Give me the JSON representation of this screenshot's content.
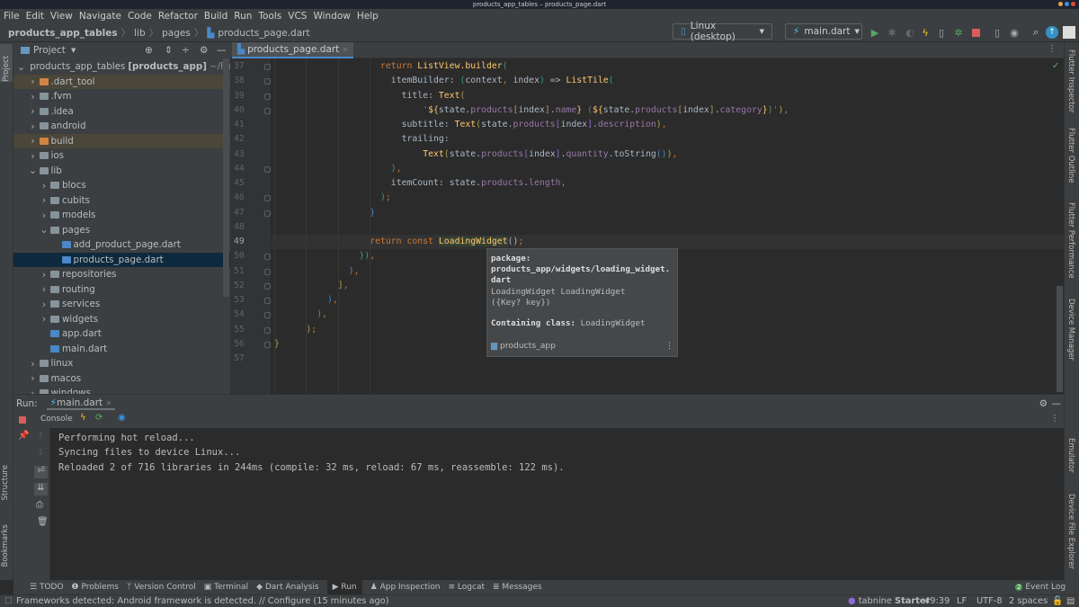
{
  "window": {
    "title": "products_app_tables – products_page.dart"
  },
  "menu": [
    "File",
    "Edit",
    "View",
    "Navigate",
    "Code",
    "Refactor",
    "Build",
    "Run",
    "Tools",
    "VCS",
    "Window",
    "Help"
  ],
  "breadcrumb": [
    "products_app_tables",
    "lib",
    "pages",
    "products_page.dart"
  ],
  "toolbar": {
    "device": "Linux (desktop)",
    "config": "main.dart",
    "icons": [
      "run-icon",
      "debug-icon",
      "profile-icon",
      "hot-reload-icon",
      "device-icon",
      "attach-debug-icon",
      "stop-icon",
      "avd-icon",
      "sdk-icon",
      "search-icon",
      "update-icon",
      "avatar-icon"
    ]
  },
  "left_strip": {
    "project": "Project",
    "structure": "Structure",
    "bookmarks": "Bookmarks"
  },
  "project_panel": {
    "title": "Project",
    "items": [
      {
        "label": "products_app_tables",
        "suffix": "[products_app]",
        "path": "~/Flutte",
        "depth": 0,
        "expanded": true,
        "type": "flutter"
      },
      {
        "label": ".dart_tool",
        "depth": 1,
        "type": "folder-excluded"
      },
      {
        "label": ".fvm",
        "depth": 1,
        "type": "folder"
      },
      {
        "label": ".idea",
        "depth": 1,
        "type": "folder"
      },
      {
        "label": "android",
        "depth": 1,
        "type": "folder"
      },
      {
        "label": "build",
        "depth": 1,
        "type": "folder-excluded"
      },
      {
        "label": "ios",
        "depth": 1,
        "type": "folder"
      },
      {
        "label": "lib",
        "depth": 1,
        "expanded": true,
        "type": "folder"
      },
      {
        "label": "blocs",
        "depth": 2,
        "type": "folder"
      },
      {
        "label": "cubits",
        "depth": 2,
        "type": "folder"
      },
      {
        "label": "models",
        "depth": 2,
        "type": "folder"
      },
      {
        "label": "pages",
        "depth": 2,
        "expanded": true,
        "type": "folder"
      },
      {
        "label": "add_product_page.dart",
        "depth": 3,
        "type": "dart"
      },
      {
        "label": "products_page.dart",
        "depth": 3,
        "type": "dart",
        "selected": true
      },
      {
        "label": "repositories",
        "depth": 2,
        "type": "folder"
      },
      {
        "label": "routing",
        "depth": 2,
        "type": "folder"
      },
      {
        "label": "services",
        "depth": 2,
        "type": "folder"
      },
      {
        "label": "widgets",
        "depth": 2,
        "type": "folder"
      },
      {
        "label": "app.dart",
        "depth": 2,
        "type": "dart"
      },
      {
        "label": "main.dart",
        "depth": 2,
        "type": "dart"
      },
      {
        "label": "linux",
        "depth": 1,
        "type": "folder"
      },
      {
        "label": "macos",
        "depth": 1,
        "type": "folder"
      },
      {
        "label": "windows",
        "depth": 1,
        "type": "folder"
      }
    ]
  },
  "editor": {
    "tab": "products_page.dart",
    "current_line": 49,
    "lines": [
      {
        "n": 37,
        "indent": 20,
        "t": [
          [
            "return ",
            "kw"
          ],
          [
            "ListView.builder",
            "fn"
          ],
          [
            "(",
            "p2"
          ]
        ]
      },
      {
        "n": 38,
        "indent": 22,
        "t": [
          [
            "itemBuilder: ",
            "pl"
          ],
          [
            "(",
            "p2"
          ],
          [
            "context",
            "pl"
          ],
          [
            ", ",
            "kw"
          ],
          [
            "index",
            "pl"
          ],
          [
            ")",
            "p2"
          ],
          [
            " => ",
            "pl"
          ],
          [
            "ListTile",
            "fn"
          ],
          [
            "(",
            "p2"
          ]
        ]
      },
      {
        "n": 39,
        "indent": 24,
        "t": [
          [
            "title: ",
            "pl"
          ],
          [
            "Text",
            "fn"
          ],
          [
            "(",
            "p3"
          ]
        ]
      },
      {
        "n": 40,
        "indent": 28,
        "t": [
          [
            "'",
            "st"
          ],
          [
            "${",
            "fn"
          ],
          [
            "state.",
            "pl"
          ],
          [
            "products",
            "pr"
          ],
          [
            "[",
            "p3"
          ],
          [
            "index",
            "pl"
          ],
          [
            "]",
            "p3"
          ],
          [
            ".",
            "pl"
          ],
          [
            "name",
            "pr"
          ],
          [
            "}",
            "fn"
          ],
          [
            " (",
            "st"
          ],
          [
            "${",
            "fn"
          ],
          [
            "state.",
            "pl"
          ],
          [
            "products",
            "pr"
          ],
          [
            "[",
            "p3"
          ],
          [
            "index",
            "pl"
          ],
          [
            "]",
            "p3"
          ],
          [
            ".",
            "pl"
          ],
          [
            "category",
            "pr"
          ],
          [
            "}",
            "fn"
          ],
          [
            ")'",
            "st"
          ],
          [
            ")",
            "p3"
          ],
          [
            ",",
            "kw"
          ]
        ]
      },
      {
        "n": 41,
        "indent": 24,
        "t": [
          [
            "subtitle: ",
            "pl"
          ],
          [
            "Text",
            "fn"
          ],
          [
            "(",
            "p3"
          ],
          [
            "state.",
            "pl"
          ],
          [
            "products",
            "pr"
          ],
          [
            "[",
            "p4"
          ],
          [
            "index",
            "pl"
          ],
          [
            "]",
            "p4"
          ],
          [
            ".",
            "pl"
          ],
          [
            "description",
            "pr"
          ],
          [
            ")",
            "p3"
          ],
          [
            ",",
            "kw"
          ]
        ]
      },
      {
        "n": 42,
        "indent": 24,
        "t": [
          [
            "trailing:",
            "pl"
          ]
        ]
      },
      {
        "n": 43,
        "indent": 28,
        "t": [
          [
            "Text",
            "fn"
          ],
          [
            "(",
            "p3"
          ],
          [
            "state.",
            "pl"
          ],
          [
            "products",
            "pr"
          ],
          [
            "[",
            "p4"
          ],
          [
            "index",
            "pl"
          ],
          [
            "]",
            "p4"
          ],
          [
            ".",
            "pl"
          ],
          [
            "quantity",
            "pr"
          ],
          [
            ".toString",
            "pl"
          ],
          [
            "()",
            "p1"
          ],
          [
            ")",
            "p3"
          ],
          [
            ",",
            "kw"
          ]
        ]
      },
      {
        "n": 44,
        "indent": 22,
        "t": [
          [
            ")",
            "p2"
          ],
          [
            ",",
            "kw"
          ]
        ]
      },
      {
        "n": 45,
        "indent": 22,
        "t": [
          [
            "itemCount: ",
            "pl"
          ],
          [
            "state.",
            "pl"
          ],
          [
            "products",
            "pr"
          ],
          [
            ".",
            "pl"
          ],
          [
            "length",
            "pr"
          ],
          [
            ",",
            "kw"
          ]
        ]
      },
      {
        "n": 46,
        "indent": 20,
        "t": [
          [
            ")",
            "p2"
          ],
          [
            ";",
            "kw"
          ]
        ]
      },
      {
        "n": 47,
        "indent": 18,
        "t": [
          [
            "}",
            "p1"
          ]
        ]
      },
      {
        "n": 48,
        "indent": 0,
        "t": []
      },
      {
        "n": 49,
        "indent": 18,
        "t": [
          [
            "return const ",
            "kw"
          ],
          [
            "LoadingWidget",
            "fn hl"
          ],
          [
            "()",
            "pl"
          ],
          [
            ";",
            "kw"
          ]
        ]
      },
      {
        "n": 50,
        "indent": 16,
        "t": [
          [
            "})",
            "p2"
          ],
          [
            ",",
            "kw"
          ]
        ]
      },
      {
        "n": 51,
        "indent": 14,
        "t": [
          [
            ")",
            "p4"
          ],
          [
            ",",
            "kw"
          ]
        ]
      },
      {
        "n": 52,
        "indent": 12,
        "t": [
          [
            "]",
            "p3"
          ],
          [
            ",",
            "kw"
          ]
        ]
      },
      {
        "n": 53,
        "indent": 10,
        "t": [
          [
            ")",
            "p1"
          ],
          [
            ",",
            "kw"
          ]
        ]
      },
      {
        "n": 54,
        "indent": 8,
        "t": [
          [
            ")",
            "p2"
          ],
          [
            ",",
            "kw"
          ]
        ]
      },
      {
        "n": 55,
        "indent": 6,
        "t": [
          [
            ")",
            "p3"
          ],
          [
            ";",
            "kw"
          ]
        ]
      },
      {
        "n": 56,
        "indent": 0,
        "t": [
          [
            "}",
            "p3"
          ]
        ]
      },
      {
        "n": 57,
        "indent": 0,
        "t": []
      }
    ]
  },
  "doc_popup": {
    "package_label": "package:",
    "package_path": "products_app/widgets/loading_widget.",
    "package_path2": "dart",
    "signature": "LoadingWidget LoadingWidget",
    "params": "({Key? key})",
    "containing_label": "Containing class:",
    "containing_value": "LoadingWidget",
    "module": "products_app"
  },
  "right_strip": [
    "Flutter Inspector",
    "Flutter Outline",
    "Flutter Performance",
    "Device Manager",
    "Emulator",
    "Device File Explorer"
  ],
  "run_panel": {
    "label": "Run:",
    "tab": "main.dart",
    "console_tab": "Console",
    "output": [
      "Performing hot reload...",
      "Syncing files to device Linux...",
      "Reloaded 2 of 716 libraries in 244ms (compile: 32 ms, reload: 67 ms, reassemble: 122 ms)."
    ]
  },
  "tool_tabs": [
    {
      "label": "TODO",
      "icon": "list-icon"
    },
    {
      "label": "Problems",
      "icon": "info-icon"
    },
    {
      "label": "Version Control",
      "icon": "branch-icon"
    },
    {
      "label": "Terminal",
      "icon": "terminal-icon"
    },
    {
      "label": "Dart Analysis",
      "icon": "dart-icon"
    },
    {
      "label": "Run",
      "icon": "play-icon",
      "active": true
    },
    {
      "label": "App Inspection",
      "icon": "inspect-icon"
    },
    {
      "label": "Logcat",
      "icon": "logcat-icon"
    },
    {
      "label": "Messages",
      "icon": "messages-icon"
    }
  ],
  "event_log": {
    "label": "Event Log",
    "count": "2"
  },
  "status": {
    "message": "Frameworks detected: Android framework is detected. // Configure (15 minutes ago)",
    "tabnine": "tabnine",
    "tabnine_plan": "Starter",
    "position": "49:39",
    "line_sep": "LF",
    "encoding": "UTF-8",
    "indent": "2 spaces"
  },
  "colors": {
    "accent": "#4a88c7",
    "keyword": "#cc7832",
    "function": "#ffc66d",
    "property": "#9876aa",
    "string": "#6a8759",
    "selection": "#0d293e"
  }
}
